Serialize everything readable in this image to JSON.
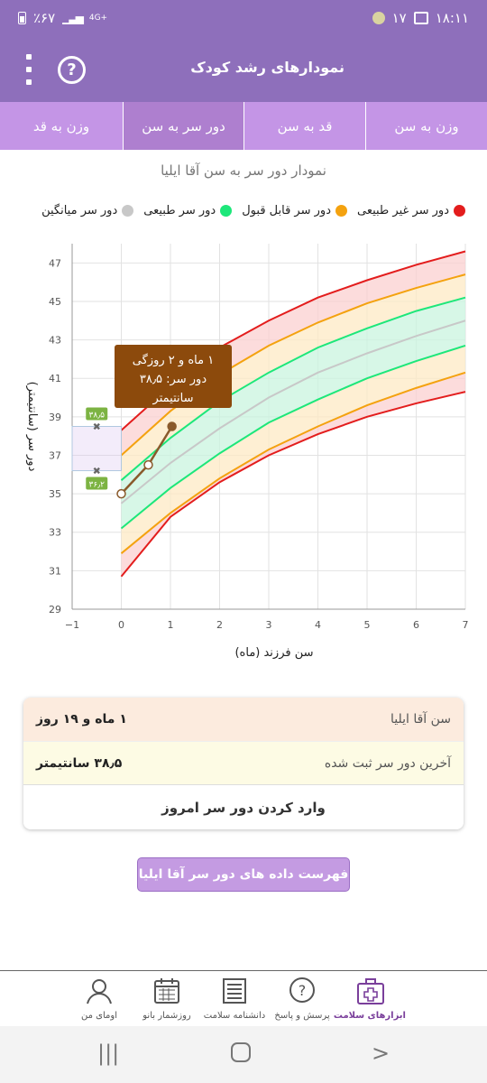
{
  "status": {
    "time": "۱۸:۱۱",
    "notif_count": "۱۷",
    "battery": "٪۶۷",
    "network": "4G+"
  },
  "app": {
    "title": "نمودارهای رشد کودک"
  },
  "tabs": [
    {
      "label": "وزن به سن",
      "active": false
    },
    {
      "label": "قد به سن",
      "active": false
    },
    {
      "label": "دور سر به سن",
      "active": true
    },
    {
      "label": "وزن به قد",
      "active": false
    }
  ],
  "chart_title": "نمودار دور سر به سن آقا ایلیا",
  "legend": [
    {
      "label": "دور سر غیر طبیعی",
      "color": "#e31d1d"
    },
    {
      "label": "دور سر قابل قبول",
      "color": "#f4a20f"
    },
    {
      "label": "دور سر طبیعی",
      "color": "#1de77a"
    },
    {
      "label": "دور سر میانگین",
      "color": "#c8c8c8"
    }
  ],
  "chart_data": {
    "type": "line",
    "xlabel": "سن فرزند (ماه)",
    "ylabel": "دور سر (سانتیمتر)",
    "xlim": [
      -1,
      7
    ],
    "ylim": [
      29,
      48
    ],
    "x_ticks": [
      "−1",
      "0",
      "1",
      "2",
      "3",
      "4",
      "5",
      "6",
      "7"
    ],
    "y_ticks": [
      "29",
      "31",
      "33",
      "35",
      "37",
      "39",
      "41",
      "43",
      "45",
      "47"
    ],
    "x": [
      0,
      1,
      2,
      3,
      4,
      5,
      6,
      7
    ],
    "series": [
      {
        "name": "دور سر غیر طبیعی",
        "values": [
          38.3,
          40.6,
          42.6,
          44.0,
          45.2,
          46.1,
          46.9,
          47.6
        ],
        "color": "#e31d1d"
      },
      {
        "name": "دور سر قابل قبول",
        "values": [
          37.0,
          39.3,
          41.2,
          42.7,
          43.9,
          44.9,
          45.7,
          46.4
        ],
        "color": "#f4a20f"
      },
      {
        "name": "دور سر طبیعی",
        "values": [
          35.7,
          37.9,
          39.8,
          41.3,
          42.6,
          43.6,
          44.5,
          45.2
        ],
        "color": "#1de77a"
      },
      {
        "name": "دور سر میانگین",
        "values": [
          34.5,
          36.6,
          38.4,
          40.0,
          41.3,
          42.3,
          43.2,
          44.0
        ],
        "color": "#c8c8c8"
      },
      {
        "name": "",
        "values": [
          33.2,
          35.3,
          37.1,
          38.7,
          39.9,
          41.0,
          41.9,
          42.7
        ],
        "color": "#1de77a"
      },
      {
        "name": "",
        "values": [
          31.9,
          34.0,
          35.8,
          37.3,
          38.5,
          39.6,
          40.5,
          41.3
        ],
        "color": "#f4a20f"
      },
      {
        "name": "",
        "values": [
          30.7,
          33.8,
          35.6,
          37.0,
          38.1,
          39.0,
          39.7,
          40.3
        ],
        "color": "#e31d1d"
      }
    ],
    "child_points": [
      {
        "x": 0,
        "y": 35.0
      },
      {
        "x": 0.55,
        "y": 36.5
      },
      {
        "x": 1.03,
        "y": 38.5
      }
    ],
    "range_markers": {
      "high": "۳۸٫۵",
      "low": "۳۶٫۲",
      "high_value": 38.5,
      "low_value": 36.2
    },
    "tooltip": {
      "line1": "۱ ماه و ۲ روزگی",
      "line2": "دور سر: ۳۸٫۵",
      "line3": "سانتیمتر"
    }
  },
  "summary": {
    "name_label": "سن آقا ایلیا",
    "age_value": "۱ ماه و ۱۹ روز",
    "last_label": "آخرین دور سر ثبت شده",
    "last_value": "۳۸٫۵ سانتیمتر",
    "enter_label": "وارد کردن دور سر امروز"
  },
  "list_button": "فهرست داده های دور سر آقا ایلیا",
  "bottom_nav": [
    {
      "label": "ابزارهای سلامت",
      "icon": "medical-kit-icon",
      "active": true
    },
    {
      "label": "پرسش و پاسخ",
      "icon": "question-icon",
      "active": false
    },
    {
      "label": "دانشنامه سلامت",
      "icon": "newspaper-icon",
      "active": false
    },
    {
      "label": "روزشمار بانو",
      "icon": "calendar-icon",
      "active": false
    },
    {
      "label": "اومای من",
      "icon": "profile-icon",
      "active": false
    }
  ]
}
